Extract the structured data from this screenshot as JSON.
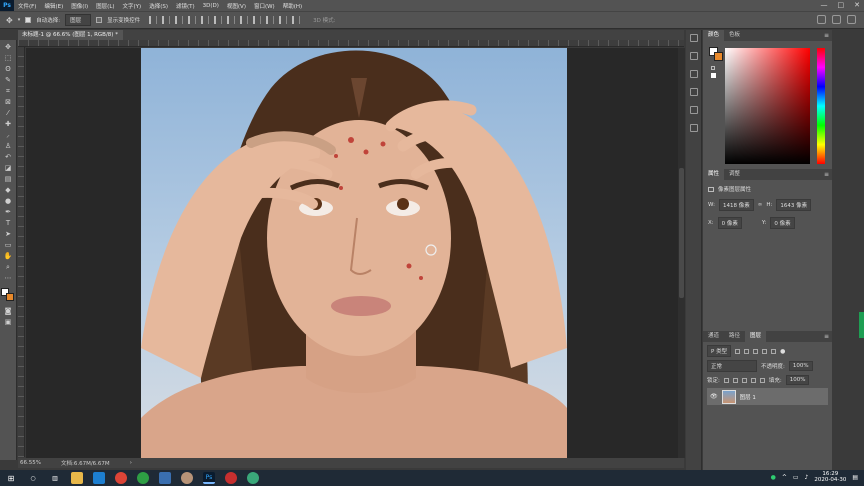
{
  "app": {
    "logo": "Ps"
  },
  "menu": [
    "文件(F)",
    "编辑(E)",
    "图像(I)",
    "图层(L)",
    "文字(Y)",
    "选择(S)",
    "滤镜(T)",
    "3D(D)",
    "视图(V)",
    "窗口(W)",
    "帮助(H)"
  ],
  "window_controls": {
    "minimize": "—",
    "maximize": "□",
    "close": "✕"
  },
  "options": {
    "auto_select_label": "自动选择:",
    "auto_select_value": "图层",
    "transform_label": "显示变换控件",
    "mode_3d_label": "3D 模式:"
  },
  "document": {
    "tab_title": "未标题-1 @ 66.6% (图层 1, RGB/8) *"
  },
  "status": {
    "zoom": "66.55%",
    "doc_info": "文档:6.67M/6.67M"
  },
  "color_panel": {
    "tabs": [
      "颜色",
      "色板"
    ],
    "fg_color": "#ffffff",
    "bg_color": "#e8892b"
  },
  "properties_panel": {
    "tabs": [
      "属性",
      "调整"
    ],
    "title": "像素图层属性",
    "w_label": "W:",
    "w_value": "1418 像素",
    "link_icon": "∞",
    "h_label": "H:",
    "h_value": "1643 像素",
    "x_label": "X:",
    "x_value": "0 像素",
    "y_label": "Y:",
    "y_value": "0 像素"
  },
  "layers_panel": {
    "tabs": [
      "通道",
      "路径",
      "图层"
    ],
    "filter_kind": "P 类型",
    "blend_mode": "正常",
    "opacity_label": "不透明度:",
    "opacity_value": "100%",
    "lock_label": "锁定:",
    "fill_label": "填充:",
    "fill_value": "100%",
    "layers": [
      {
        "name": "图层 1",
        "visible": true
      }
    ]
  },
  "taskbar": {
    "time": "16:29",
    "date": "2020-04-30",
    "ps_label": "Ps"
  }
}
